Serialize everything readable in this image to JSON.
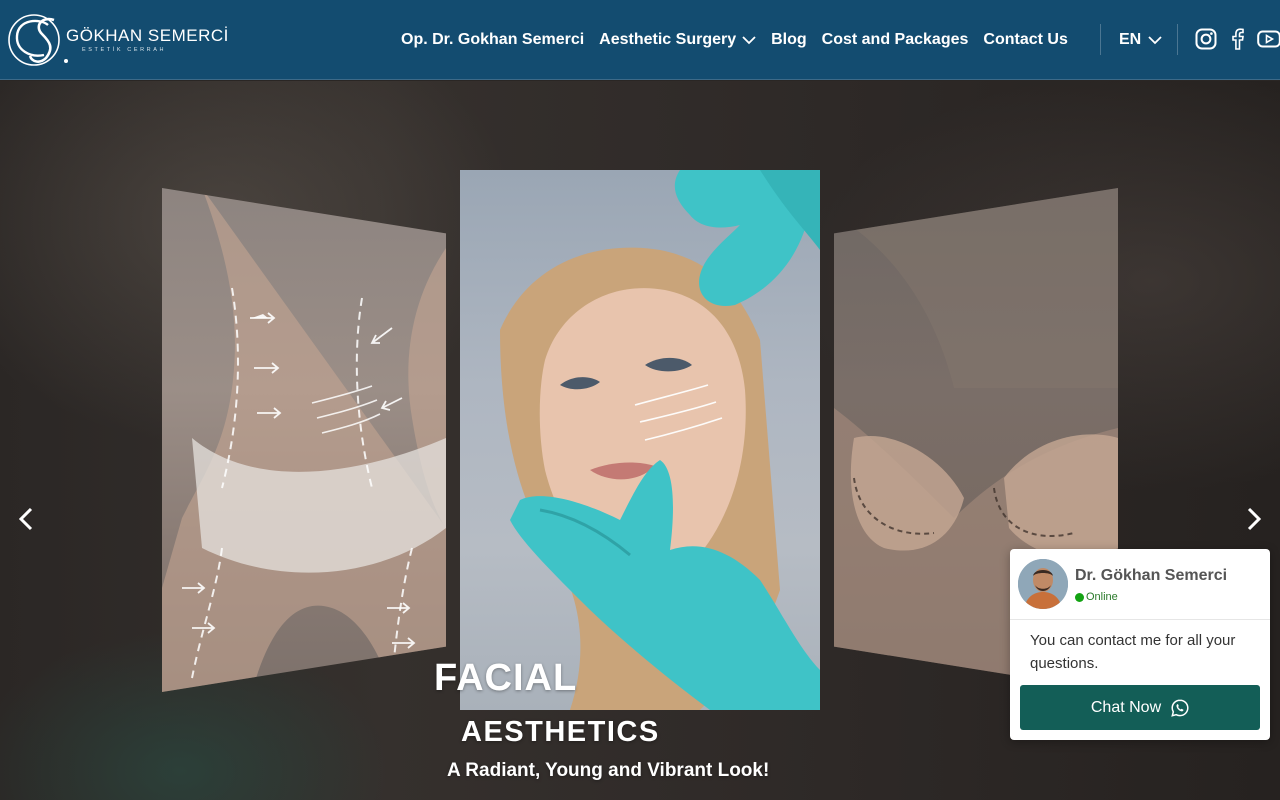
{
  "brand": {
    "name": "GÖKHAN SEMERCİ",
    "subtitle": "ESTETİK CERRAH"
  },
  "nav": {
    "items": [
      {
        "label": "Op. Dr. Gokhan Semerci",
        "has_dropdown": false
      },
      {
        "label": "Aesthetic Surgery",
        "has_dropdown": true
      },
      {
        "label": "Blog",
        "has_dropdown": false
      },
      {
        "label": "Cost and Packages",
        "has_dropdown": false
      },
      {
        "label": "Contact Us",
        "has_dropdown": false
      }
    ],
    "language": "EN"
  },
  "social": [
    "instagram-icon",
    "facebook-icon",
    "youtube-icon"
  ],
  "hero": {
    "slides": [
      {
        "position": "left",
        "subject": "body contouring"
      },
      {
        "position": "center",
        "title": "FACIAL",
        "subtitle": "AESTHETICS",
        "tagline": "A Radiant, Young and Vibrant Look!"
      },
      {
        "position": "right",
        "subject": "breast aesthetics"
      }
    ]
  },
  "chat": {
    "name": "Dr. Gökhan Semerci",
    "status": "Online",
    "message": "You can contact me for all your questions.",
    "button_label": "Chat Now"
  },
  "colors": {
    "header_bg": "#134c70",
    "chat_button": "#135e57",
    "online": "#13a313",
    "glove": "#3fc3c7"
  }
}
